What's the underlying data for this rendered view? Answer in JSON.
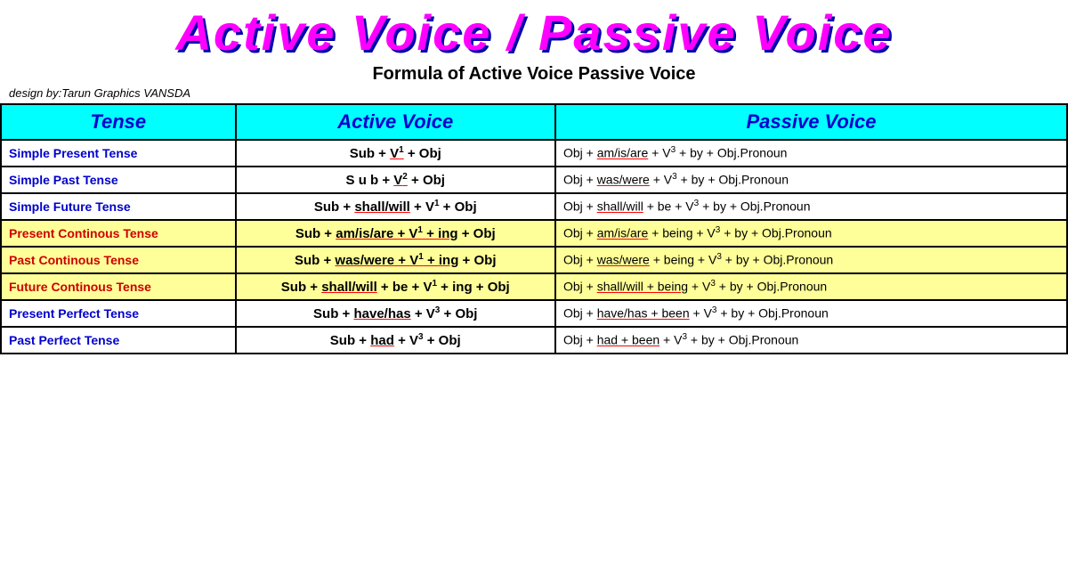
{
  "header": {
    "main_title": "Active Voice / Passive Voice",
    "subtitle": "Formula of Active Voice Passive Voice",
    "credit": "design by:Tarun Graphics VANSDA"
  },
  "table": {
    "columns": [
      "Tense",
      "Active Voice",
      "Passive Voice"
    ],
    "rows": [
      {
        "tense": "Simple Present Tense",
        "tense_color": "blue",
        "active": "Sub + V¹ + Obj",
        "active_underline": "V¹",
        "passive": "Obj + am/is/are + V³ + by + Obj.Pronoun",
        "passive_underline": "am/is/are",
        "row_style": "white"
      },
      {
        "tense": "Simple Past Tense",
        "tense_color": "blue",
        "active": "Sub + V² + Obj",
        "active_underline": "V²",
        "passive": "Obj + was/were + V³ + by + Obj.Pronoun",
        "passive_underline": "was/were",
        "row_style": "white"
      },
      {
        "tense": "Simple Future Tense",
        "tense_color": "blue",
        "active": "Sub + shall/will + V¹ + Obj",
        "active_underline": "shall/will",
        "passive": "Obj + shall/will + be + V³ + by + Obj.Pronoun",
        "passive_underline": "shall/will",
        "row_style": "white"
      },
      {
        "tense": "Present Continous Tense",
        "tense_color": "red",
        "active": "Sub + am/is/are + V¹ + ing + Obj",
        "active_underline": "am/is/are + V¹ + ing",
        "passive": "Obj + am/is/are + being + V³ + by + Obj.Pronoun",
        "passive_underline": "am/is/are",
        "row_style": "yellow"
      },
      {
        "tense": "Past Continous Tense",
        "tense_color": "red",
        "active": "Sub + was/were + V¹ + ing + Obj",
        "active_underline": "was/were + V¹ + ing",
        "passive": "Obj + was/were + being + V³ + by + Obj.Pronoun",
        "passive_underline": "was/were",
        "row_style": "yellow"
      },
      {
        "tense": "Future Continous Tense",
        "tense_color": "red",
        "active": "Sub + shall/will + be + V¹ + ing + Obj",
        "active_underline": "shall/will",
        "passive": "Obj + shall/will + being + V³ + by + Obj.Pronoun",
        "passive_underline": "shall/will + being",
        "row_style": "yellow"
      },
      {
        "tense": "Present Perfect Tense",
        "tense_color": "blue",
        "active": "Sub + have/has + V³ + Obj",
        "active_underline": "have/has",
        "passive": "Obj + have/has + been + V³ + by + Obj.Pronoun",
        "passive_underline": "have/has + been",
        "row_style": "white"
      },
      {
        "tense": "Past Perfect Tense",
        "tense_color": "blue",
        "active": "Sub + had + V³ + Obj",
        "active_underline": "had",
        "passive": "Obj + had + been + V³ + by + Obj.Pronoun",
        "passive_underline": "had + been",
        "row_style": "white"
      }
    ]
  }
}
